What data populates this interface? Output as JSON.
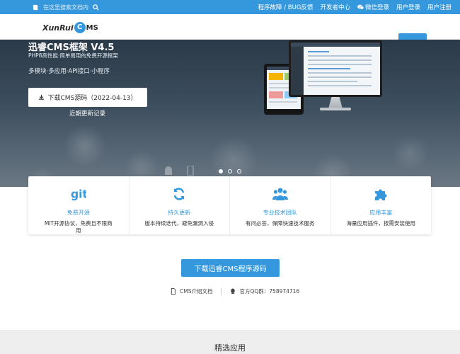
{
  "topbar": {
    "search_placeholder": "在这里搜索文档内",
    "links": [
      "程序故障 / BUG反馈",
      "开发者中心",
      "微信登录",
      "用户登录",
      "用户注册"
    ]
  },
  "logo": {
    "part1": "XunRui",
    "part2": "MS",
    "c_letter": "C"
  },
  "hero": {
    "title": "迅睿CMS框架 V4.5",
    "subtitle": "PHP8高性能·简单易用的免费开源框架",
    "tagline": "多模块·多应用·API接口·小程序",
    "download_label": "下载CMS源码（2022-04-13）",
    "changelog_label": "近期更新记录"
  },
  "features": [
    {
      "icon": "git-icon",
      "name": "免费开源",
      "desc": "MIT开源协议，免费且不限商用"
    },
    {
      "icon": "refresh-icon",
      "name": "持久更新",
      "desc": "版本持续迭代，避免漏洞入侵"
    },
    {
      "icon": "team-icon",
      "name": "专业技术团队",
      "desc": "有问必答，保障快速技术服务"
    },
    {
      "icon": "puzzle-icon",
      "name": "应用丰富",
      "desc": "海量应用插件，按需安装使用"
    }
  ],
  "download_big_label": "下载迅睿CMS程序源码",
  "meta": {
    "docs_label": "CMS介绍文档",
    "qq_label": "官方QQ群：758974716"
  },
  "apps_heading": "精选应用",
  "colors": {
    "brand": "#3598dc"
  }
}
